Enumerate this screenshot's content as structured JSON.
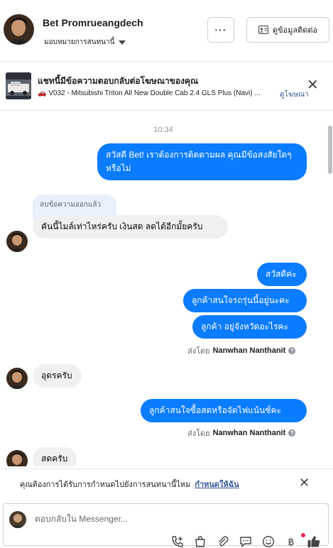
{
  "header": {
    "name": "Bet Promrueangdech",
    "assign_label": "มอบหมายการสนทนานี้",
    "more_label": "···",
    "contact_button": "ดูข้อมูลติดต่อ"
  },
  "ad_banner": {
    "title": "แชทนี้มีข้อความตอบกลับต่อโฆษณาของคุณ",
    "subtitle": "🚗 V032 - Mitsubishi Triton All New Double Cab 2.4 GLS Plus (Navi) ...",
    "link": "ดูโฆษณา"
  },
  "conversation": {
    "timestamp": "10:34",
    "messages": [
      {
        "text": "สวัสดี Bet! เราต้องการติดตามผล คุณมีข้อสงสัยใดๆ หรือไม่"
      },
      {
        "deleted_label": "ลบข้อความออกแล้ว"
      },
      {
        "text": "คันนี้ไมล์เท่าไหร่ครับ เงินสด ลดได้อีกมั้ยครับ"
      },
      {
        "text": "สวัสดีค่ะ"
      },
      {
        "text": "ลูกค้าสนใจรถรุ่นนี้อยู่นะคะ"
      },
      {
        "text": "ลูกค้า อยู่จังหวัดอะไรคะ"
      },
      {
        "text": "อุดรครับ"
      },
      {
        "text": "ลูกค้าสนใจซื้อสดหรือจัดไฟแน้นซ์คะ"
      },
      {
        "text": "สดครับ"
      }
    ],
    "sent_by_prefix": "ส่งโดย",
    "sent_by_name": "Nanwhan Nanthanit"
  },
  "reminder": {
    "text": "คุณต้องการได้รับการกำหนดไปยังการสนทนานี้ไหม",
    "link": "กำหนดให้ฉัน"
  },
  "composer": {
    "placeholder": "ตอบกลับใน Messenger..."
  },
  "icons": [
    "more-icon",
    "contact-card-icon",
    "close-icon",
    "help-icon",
    "add-call-icon",
    "shopping-bag-icon",
    "attachment-icon",
    "saved-reply-icon",
    "emoji-icon",
    "baht-icon",
    "like-icon"
  ],
  "colors": {
    "outgoing_bubble": "#0a7cff",
    "incoming_bubble": "#f0f0f0",
    "link": "#385898",
    "notification_dot": "#f02849"
  }
}
